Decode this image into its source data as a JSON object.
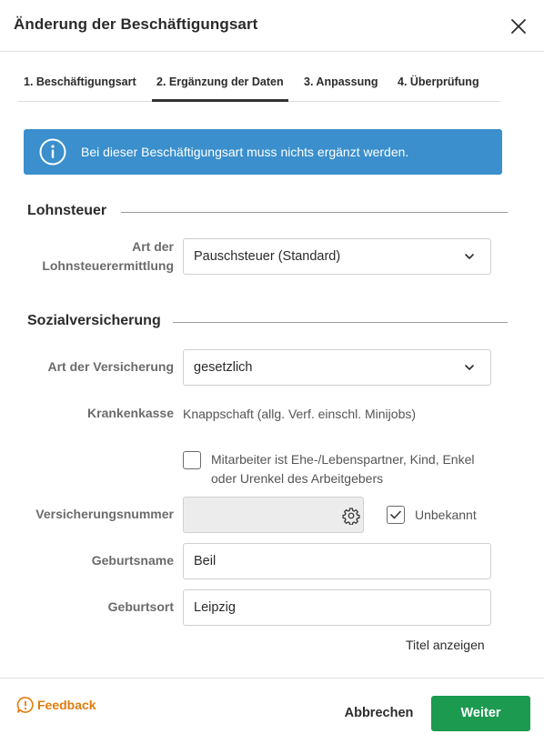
{
  "dialog": {
    "title": "Änderung der Beschäftigungsart",
    "close_icon": "close-icon"
  },
  "tabs": [
    {
      "label": "1. Beschäftigungsart",
      "active": false
    },
    {
      "label": "2. Ergänzung der Daten",
      "active": true
    },
    {
      "label": "3. Anpassung",
      "active": false
    },
    {
      "label": "4. Überprüfung",
      "active": false
    }
  ],
  "info_banner": {
    "icon": "info-icon",
    "text": "Bei dieser Beschäftigungsart muss nichts ergänzt werden.",
    "color": "#3a8fcc"
  },
  "lohnsteuer": {
    "heading": "Lohnsteuer",
    "art_label_line1": "Art der",
    "art_label_line2": "Lohnsteuerermittlung",
    "art_value": "Pauschsteuer (Standard)"
  },
  "sozialversicherung": {
    "heading": "Sozialversicherung",
    "versicherung_label": "Art der Versicherung",
    "versicherung_value": "gesetzlich",
    "krankenkasse_label": "Krankenkasse",
    "krankenkasse_value": "Knappschaft (allg. Verf. einschl. Minijobs)",
    "family_checkbox_line1": "Mitarbeiter ist Ehe-/Lebenspartner, Kind, Enkel",
    "family_checkbox_line2": "oder Urenkel des Arbeitgebers",
    "family_checked": false,
    "versicherungsnummer_label": "Versicherungsnummer",
    "versicherungsnummer_value": "",
    "unbekannt_label": "Unbekannt",
    "unbekannt_checked": true,
    "geburtsname_label": "Geburtsname",
    "geburtsname_value": "Beil",
    "geburtsort_label": "Geburtsort",
    "geburtsort_value": "Leipzig",
    "titel_link": "Titel anzeigen"
  },
  "footer": {
    "feedback_label": "Feedback",
    "feedback_color": "#e07c0d",
    "cancel_label": "Abbrechen",
    "next_label": "Weiter",
    "next_color": "#1b9a50"
  }
}
